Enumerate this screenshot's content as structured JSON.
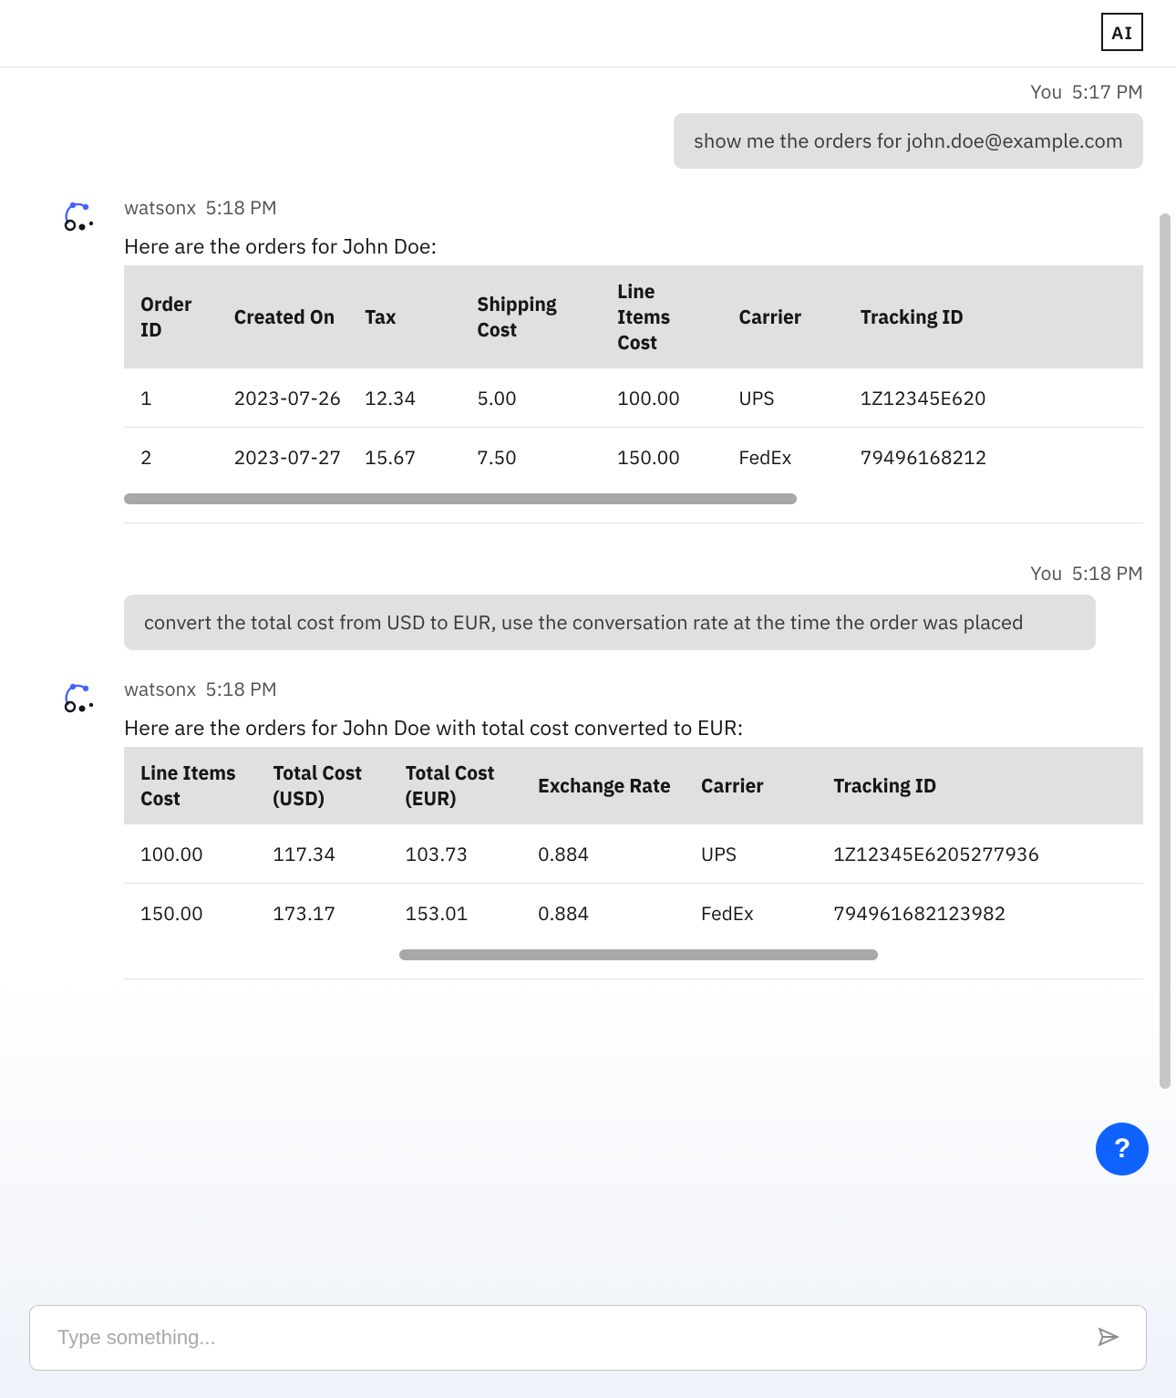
{
  "header": {
    "ai_badge": "AI"
  },
  "composer": {
    "placeholder": "Type something..."
  },
  "help_label": "?",
  "messages": [
    {
      "role": "user",
      "name": "You",
      "time": "5:17 PM",
      "text": "show me the orders for john.doe@example.com"
    },
    {
      "role": "bot",
      "name": "watsonx",
      "time": "5:18 PM",
      "intro": "Here are the orders for John Doe:",
      "table": {
        "headers": [
          "Order ID",
          "Created On",
          "Tax",
          "Shipping Cost",
          "Line Items Cost",
          "Carrier",
          "Tracking ID"
        ],
        "rows": [
          [
            "1",
            "2023-07-26",
            "12.34",
            "5.00",
            "100.00",
            "UPS",
            "1Z12345E620"
          ],
          [
            "2",
            "2023-07-27",
            "15.67",
            "7.50",
            "150.00",
            "FedEx",
            "79496168212"
          ]
        ]
      }
    },
    {
      "role": "user",
      "name": "You",
      "time": "5:18 PM",
      "text": "convert the total cost from USD to EUR, use the conversation rate at the time the order was placed"
    },
    {
      "role": "bot",
      "name": "watsonx",
      "time": "5:18 PM",
      "intro": "Here are the orders for John Doe with total cost converted to EUR:",
      "table": {
        "headers": [
          "Line Items Cost",
          "Total Cost (USD)",
          "Total Cost (EUR)",
          "Exchange Rate",
          "Carrier",
          "Tracking ID"
        ],
        "rows": [
          [
            "100.00",
            "117.34",
            "103.73",
            "0.884",
            "UPS",
            "1Z12345E6205277936"
          ],
          [
            "150.00",
            "173.17",
            "153.01",
            "0.884",
            "FedEx",
            "794961682123982"
          ]
        ]
      }
    }
  ]
}
